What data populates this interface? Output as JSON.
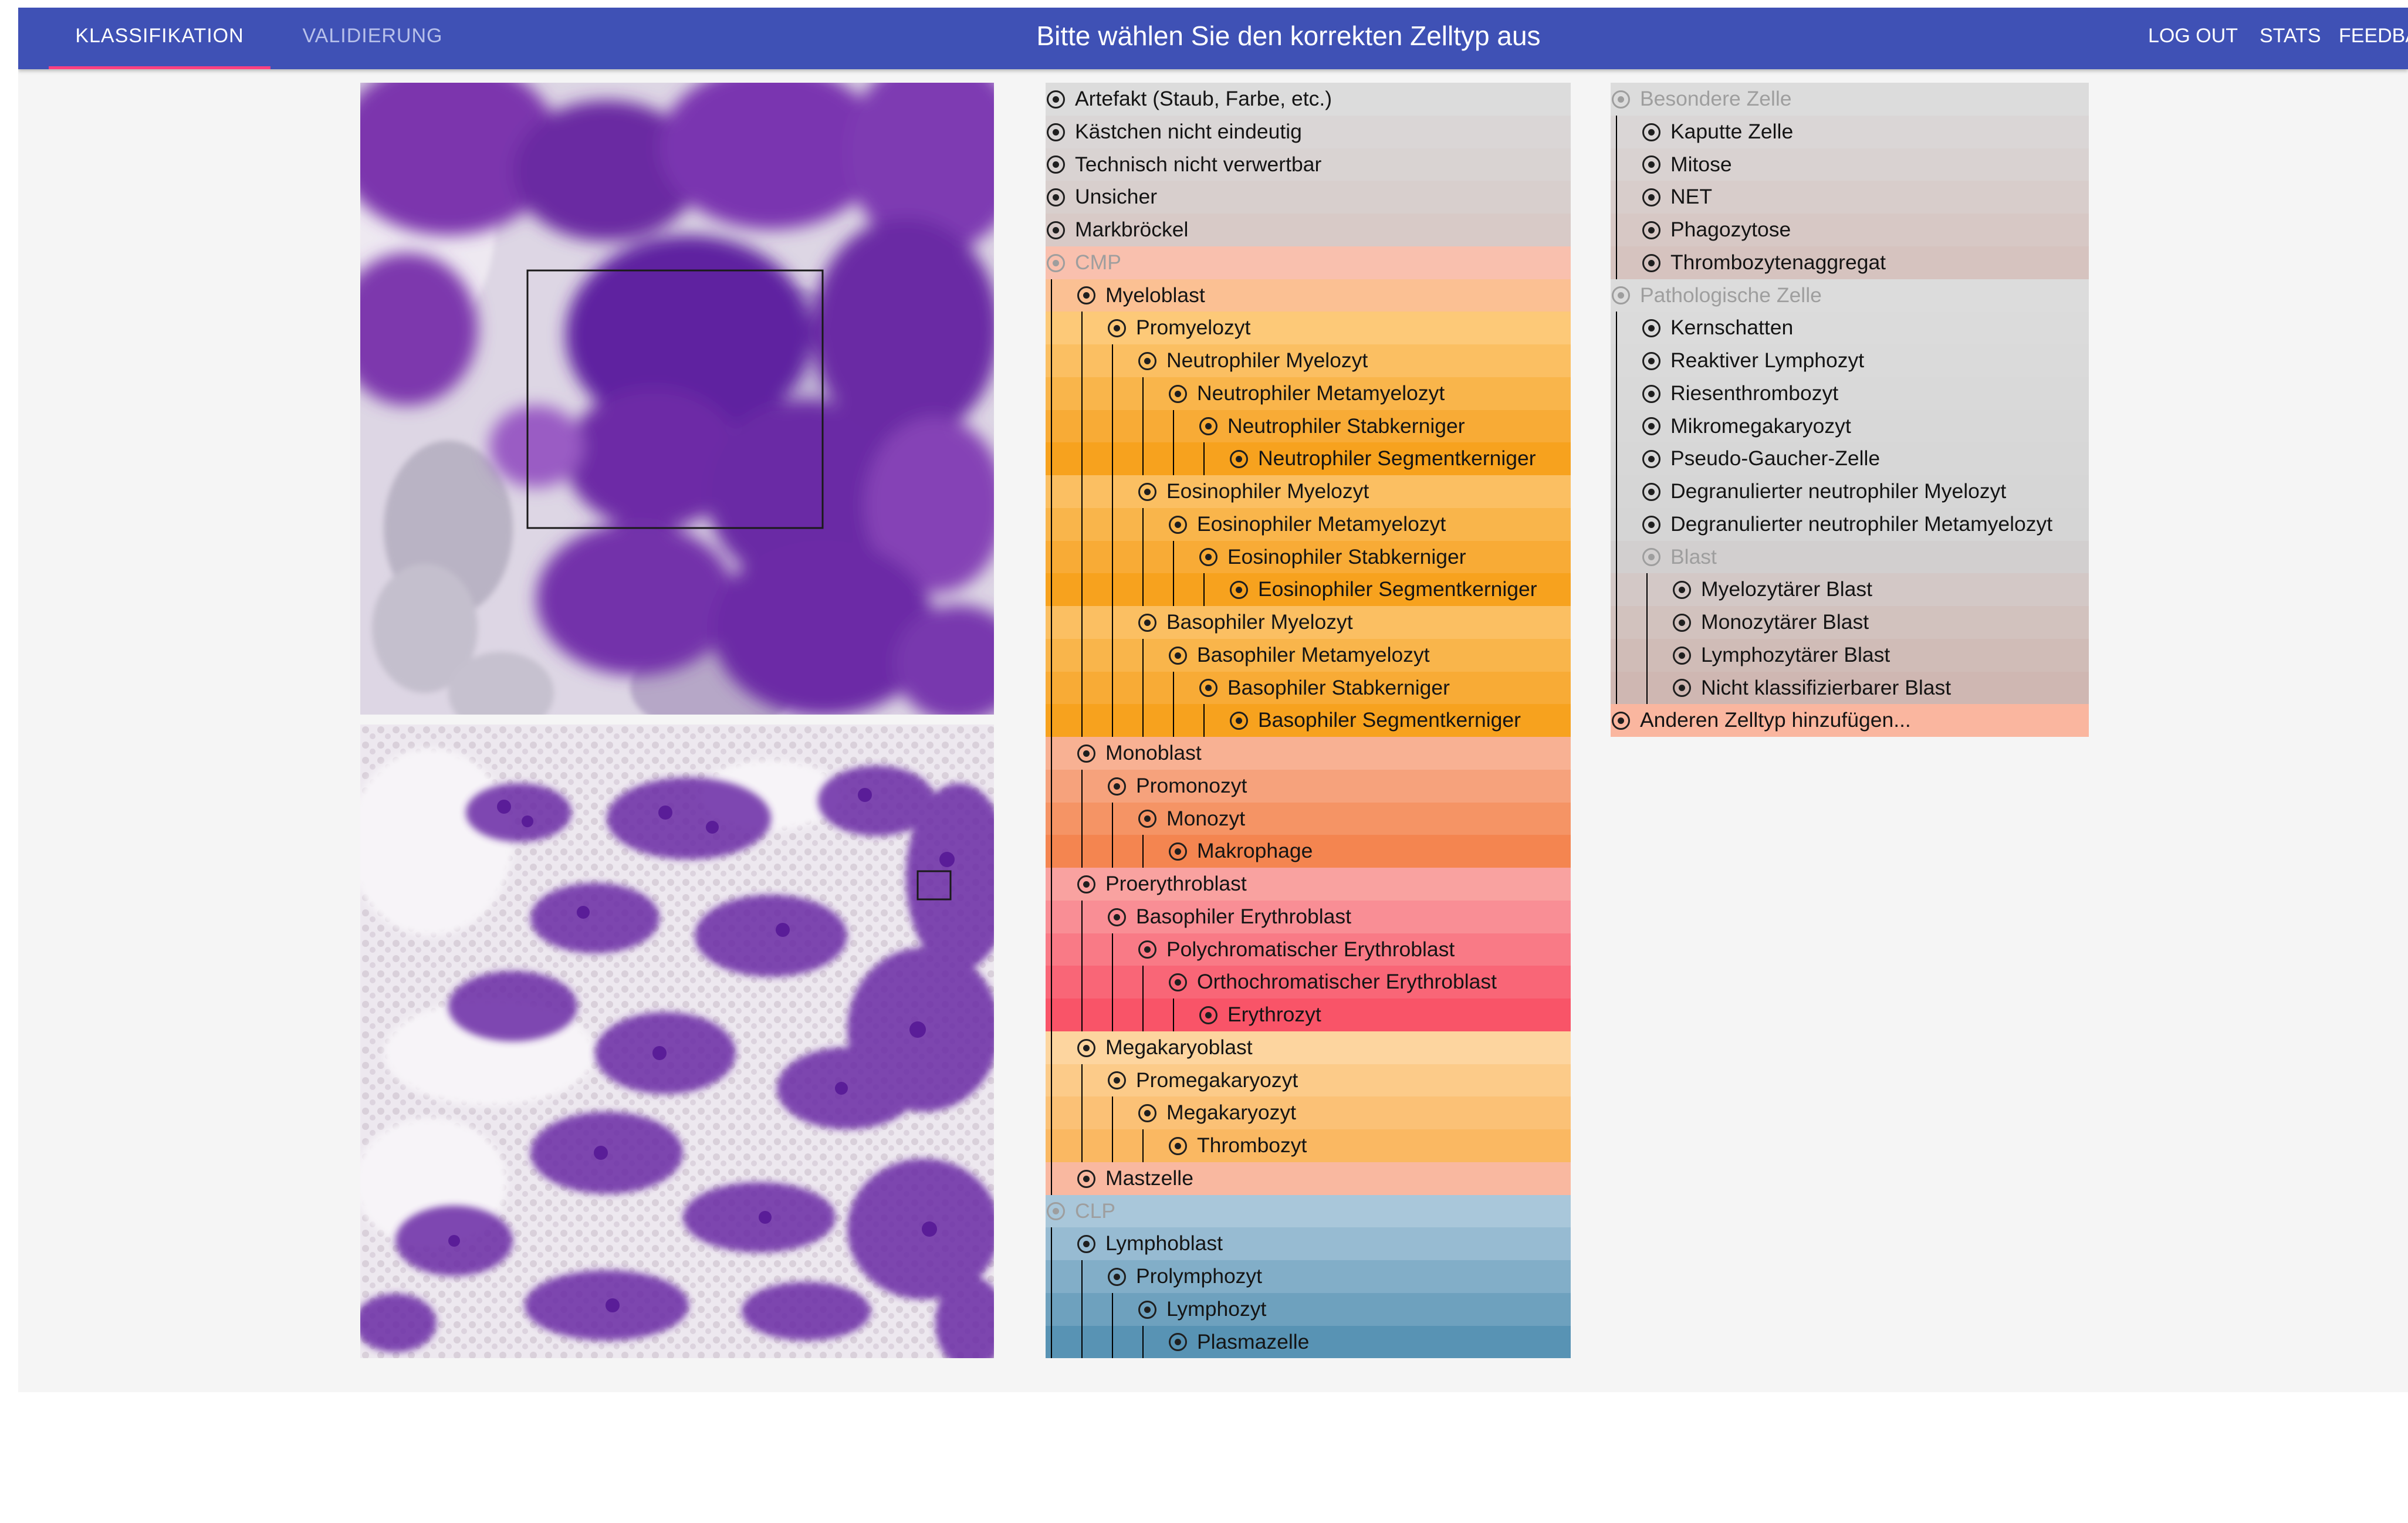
{
  "nav": {
    "tabs": [
      "KLASSIFIKATION",
      "VALIDIERUNG"
    ],
    "title": "Bitte wählen Sie den korrekten Zelltyp aus",
    "actions": [
      "LOG OUT",
      "STATS",
      "FEEDBACK"
    ]
  },
  "colors": {
    "appbar": "#3f51b5",
    "active_indicator": "#ff4081",
    "page_background": "#f5f5f5"
  },
  "images": {
    "zoom": "cell-zoom-micrograph",
    "overview": "smear-overview-micrograph"
  },
  "tree_main": [
    {
      "label": "Artefakt (Staub, Farbe, etc.)",
      "depth": 0,
      "color": "#dcdcdc"
    },
    {
      "label": "Kästchen nicht eindeutig",
      "depth": 0,
      "color": "#dad6d6"
    },
    {
      "label": "Technisch nicht verwertbar",
      "depth": 0,
      "color": "#d9d3d2"
    },
    {
      "label": "Unsicher",
      "depth": 0,
      "color": "#d8cfcd"
    },
    {
      "label": "Markbröckel",
      "depth": 0,
      "color": "#d8cac7"
    },
    {
      "label": "CMP",
      "depth": 0,
      "color": "#f9c0ae",
      "disabled": true
    },
    {
      "label": "Myeloblast",
      "depth": 1,
      "color": "#fbc093"
    },
    {
      "label": "Promyelozyt",
      "depth": 2,
      "color": "#fdc978"
    },
    {
      "label": "Neutrophiler Myelozyt",
      "depth": 3,
      "color": "#fbbf62"
    },
    {
      "label": "Neutrophiler Metamyelozyt",
      "depth": 4,
      "color": "#f9b54b"
    },
    {
      "label": "Neutrophiler Stabkerniger",
      "depth": 5,
      "color": "#f8ab36"
    },
    {
      "label": "Neutrophiler Segmentkerniger",
      "depth": 6,
      "color": "#f7a21e"
    },
    {
      "label": "Eosinophiler Myelozyt",
      "depth": 3,
      "color": "#fbbf62"
    },
    {
      "label": "Eosinophiler Metamyelozyt",
      "depth": 4,
      "color": "#f9b54b"
    },
    {
      "label": "Eosinophiler Stabkerniger",
      "depth": 5,
      "color": "#f8ab36"
    },
    {
      "label": "Eosinophiler Segmentkerniger",
      "depth": 6,
      "color": "#f7a21e"
    },
    {
      "label": "Basophiler Myelozyt",
      "depth": 3,
      "color": "#fbbf62"
    },
    {
      "label": "Basophiler Metamyelozyt",
      "depth": 4,
      "color": "#f9b54b"
    },
    {
      "label": "Basophiler Stabkerniger",
      "depth": 5,
      "color": "#f8ab36"
    },
    {
      "label": "Basophiler Segmentkerniger",
      "depth": 6,
      "color": "#f7a21e"
    },
    {
      "label": "Monoblast",
      "depth": 1,
      "color": "#f8b193"
    },
    {
      "label": "Promonozyt",
      "depth": 2,
      "color": "#f6a27c"
    },
    {
      "label": "Monozyt",
      "depth": 3,
      "color": "#f59465"
    },
    {
      "label": "Makrophage",
      "depth": 4,
      "color": "#f48550"
    },
    {
      "label": "Proerythroblast",
      "depth": 1,
      "color": "#f9a2a0"
    },
    {
      "label": "Basophiler Erythroblast",
      "depth": 2,
      "color": "#f98e95"
    },
    {
      "label": "Polychromatischer Erythroblast",
      "depth": 3,
      "color": "#f97a86"
    },
    {
      "label": "Orthochromatischer Erythroblast",
      "depth": 4,
      "color": "#f96677"
    },
    {
      "label": "Erythrozyt",
      "depth": 5,
      "color": "#f95468"
    },
    {
      "label": "Megakaryoblast",
      "depth": 1,
      "color": "#fdd59f"
    },
    {
      "label": "Promegakaryozyt",
      "depth": 2,
      "color": "#fccb89"
    },
    {
      "label": "Megakaryozyt",
      "depth": 3,
      "color": "#fbc176"
    },
    {
      "label": "Thrombozyt",
      "depth": 4,
      "color": "#fab862"
    },
    {
      "label": "Mastzelle",
      "depth": 1,
      "color": "#f9b8a0"
    },
    {
      "label": "CLP",
      "depth": 0,
      "color": "#a9c7da",
      "disabled": true
    },
    {
      "label": "Lymphoblast",
      "depth": 1,
      "color": "#97bbd2"
    },
    {
      "label": "Prolymphozyt",
      "depth": 2,
      "color": "#82aec8"
    },
    {
      "label": "Lymphozyt",
      "depth": 3,
      "color": "#6ea1be"
    },
    {
      "label": "Plasmazelle",
      "depth": 4,
      "color": "#5893b4"
    }
  ],
  "tree_side": [
    {
      "label": "Besondere Zelle",
      "depth": 0,
      "color": "#dcdcdc",
      "disabled": true
    },
    {
      "label": "Kaputte Zelle",
      "depth": 1,
      "color": "#dad6d6"
    },
    {
      "label": "Mitose",
      "depth": 1,
      "color": "#d9d2d1"
    },
    {
      "label": "NET",
      "depth": 1,
      "color": "#d8cdcb"
    },
    {
      "label": "Phagozytose",
      "depth": 1,
      "color": "#d7c8c5"
    },
    {
      "label": "Thrombozytenaggregat",
      "depth": 1,
      "color": "#d6c3bf"
    },
    {
      "label": "Pathologische Zelle",
      "depth": 0,
      "color": "#dcdcdc",
      "disabled": true
    },
    {
      "label": "Kernschatten",
      "depth": 1,
      "color": "#dbdbdb"
    },
    {
      "label": "Reaktiver Lymphozyt",
      "depth": 1,
      "color": "#dadada"
    },
    {
      "label": "Riesenthrombozyt",
      "depth": 1,
      "color": "#d9d9d9"
    },
    {
      "label": "Mikromegakaryozyt",
      "depth": 1,
      "color": "#d8d8d8"
    },
    {
      "label": "Pseudo-Gaucher-Zelle",
      "depth": 1,
      "color": "#d7d7d7"
    },
    {
      "label": "Degranulierter neutrophiler Myelozyt",
      "depth": 1,
      "color": "#d6d6d6"
    },
    {
      "label": "Degranulierter neutrophiler Metamyelozyt",
      "depth": 1,
      "color": "#d5d5d5"
    },
    {
      "label": "Blast",
      "depth": 1,
      "color": "#d2cfcf",
      "disabled": true
    },
    {
      "label": "Myelozytärer Blast",
      "depth": 2,
      "color": "#d3c8c6"
    },
    {
      "label": "Monozytärer Blast",
      "depth": 2,
      "color": "#d2c2be"
    },
    {
      "label": "Lymphozytärer Blast",
      "depth": 2,
      "color": "#d0bcb7"
    },
    {
      "label": "Nicht klassifizierbarer Blast",
      "depth": 2,
      "color": "#cfb7b2"
    },
    {
      "label": "Anderen Zelltyp hinzufügen...",
      "depth": 0,
      "color": "#fab69f"
    }
  ]
}
